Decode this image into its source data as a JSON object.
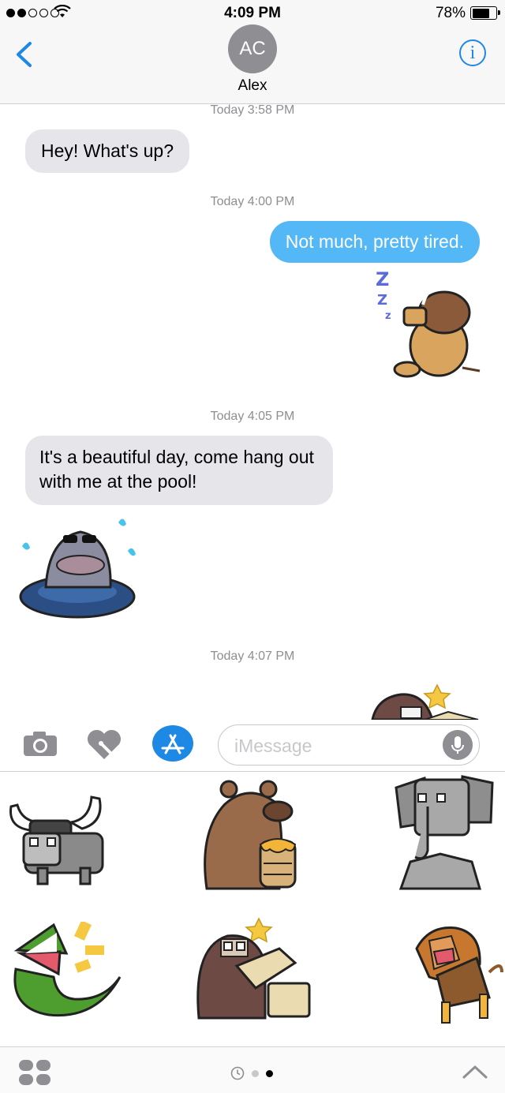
{
  "status_bar": {
    "time": "4:09 PM",
    "battery": "78%"
  },
  "header": {
    "avatar_initials": "AC",
    "contact_name": "Alex"
  },
  "messages": {
    "ts1": "Today 3:58 PM",
    "msg1": "Hey! What's up?",
    "ts2": "Today 4:00 PM",
    "msg2": "Not much, pretty tired.",
    "ts3": "Today 4:05 PM",
    "msg3_line1": "It's a beautiful day, come hang out",
    "msg3_line2": "with me at the pool!",
    "ts4": "Today 4:07 PM"
  },
  "input": {
    "placeholder": "iMessage"
  },
  "sticker_pack": {
    "stickers": [
      "buffalo",
      "bear-with-honey",
      "elephant",
      "crocodile",
      "gorilla",
      "lion"
    ]
  },
  "colors": {
    "accent": "#1e88e5",
    "outgoing_bubble": "#54b8f6",
    "incoming_bubble": "#e5e5ea"
  }
}
